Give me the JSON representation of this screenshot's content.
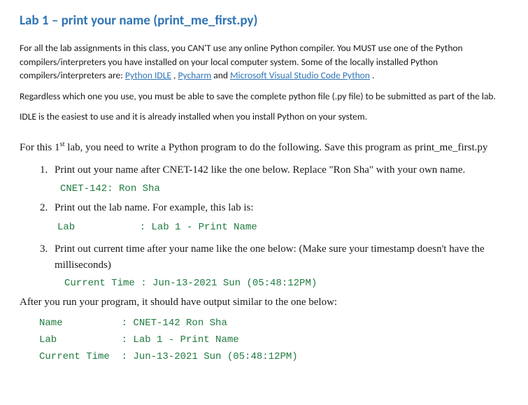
{
  "title": "Lab 1 – print your name (print_me_first.py)",
  "intro": {
    "p1_a": "For all the lab assignments in this class, you CAN'T use any online Python compiler.  You MUST use one of the Python compilers/interpreters you have installed on your local computer system.  Some of the locally installed Python compilers/interpreters are: ",
    "link1": "Python IDLE",
    "sep1": ", ",
    "link2": "Pycharm",
    "sep2": " and ",
    "link3": "Microsoft Visual Studio Code Python",
    "p1_end": ".",
    "p2": "Regardless which one you use, you must be able to save the complete python file (.py file) to be submitted as part of the lab.",
    "p3": "IDLE is the easiest to use and it is already installed when you install Python on your system."
  },
  "task_intro_a": "For this 1",
  "task_intro_sup": "st",
  "task_intro_b": " lab, you need to write a Python program to do the following.  Save this program as print_me_first.py",
  "steps": {
    "s1": "Print out your name after CNET-142 like the one below.  Replace \"Ron Sha\" with your own name.",
    "s1_code": "CNET-142: Ron Sha",
    "s2": "Print out the lab name.  For example, this lab is:",
    "s2_code": "Lab           : Lab 1 - Print Name",
    "s3": "Print out current time after your name like the one below: (Make sure your timestamp doesn't have the milliseconds)",
    "s3_code": "Current Time : Jun-13-2021 Sun (05:48:12PM)"
  },
  "closing": "After you run your program, it should have output similar to the one below:",
  "output_l1": "Name          : CNET-142 Ron Sha",
  "output_l2": "Lab           : Lab 1 - Print Name",
  "output_l3": "Current Time  : Jun-13-2021 Sun (05:48:12PM)"
}
